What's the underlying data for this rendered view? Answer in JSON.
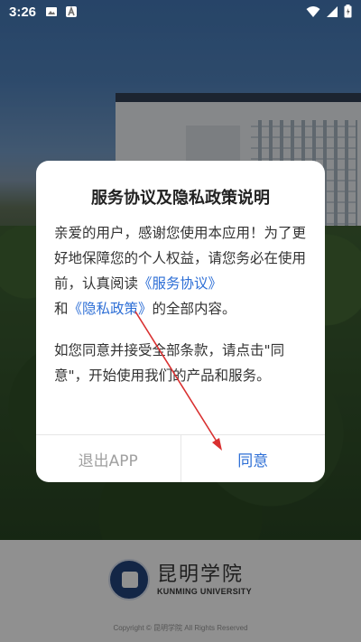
{
  "status_bar": {
    "time": "3:26",
    "icons_left": [
      "image-icon",
      "a-badge-icon"
    ],
    "icons_right": [
      "wifi-icon",
      "signal-icon",
      "battery-icon"
    ]
  },
  "dialog": {
    "title": "服务协议及隐私政策说明",
    "paragraph1": {
      "text_before": "亲爱的用户，感谢您使用本应用！为了更好地保障您的个人权益，请您务必在使用前，认真阅读",
      "link_service": "《服务协议》",
      "text_and": "和",
      "link_privacy": "《隐私政策》",
      "text_after": "的全部内容。"
    },
    "paragraph2": "如您同意并接受全部条款，请点击\"同意\"，开始使用我们的产品和服务。",
    "exit_label": "退出APP",
    "agree_label": "同意"
  },
  "footer": {
    "logo_cn": "昆明学院",
    "logo_en": "KUNMING UNIVERSITY",
    "copyright": "Copyright © 昆明学院 All Rights Reserved"
  },
  "colors": {
    "link": "#2e6fd6",
    "annotation_arrow": "#d93030"
  }
}
